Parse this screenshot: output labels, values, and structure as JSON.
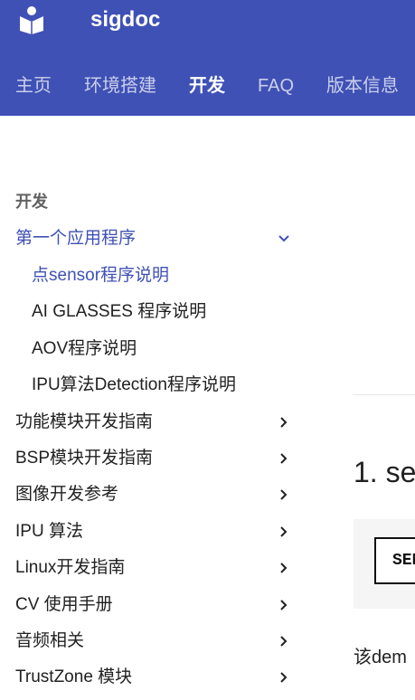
{
  "header": {
    "site_title": "sigdoc",
    "tabs": [
      {
        "label": "主页",
        "active": false
      },
      {
        "label": "环境搭建",
        "active": false
      },
      {
        "label": "开发",
        "active": true
      },
      {
        "label": "FAQ",
        "active": false
      },
      {
        "label": "版本信息",
        "active": false
      }
    ]
  },
  "nav": {
    "section_title": "开发",
    "items": [
      {
        "label": "第一个应用程序",
        "icon": "chevron-down-icon",
        "active": true
      },
      {
        "label": "点sensor程序说明",
        "active": true
      },
      {
        "label": "AI GLASSES 程序说明"
      },
      {
        "label": "AOV程序说明"
      },
      {
        "label": "IPU算法Detection程序说明"
      },
      {
        "label": "功能模块开发指南",
        "icon": "chevron-right-icon"
      },
      {
        "label": "BSP模块开发指南",
        "icon": "chevron-right-icon"
      },
      {
        "label": "图像开发参考",
        "icon": "chevron-right-icon"
      },
      {
        "label": "IPU 算法",
        "icon": "chevron-right-icon"
      },
      {
        "label": "Linux开发指南",
        "icon": "chevron-right-icon"
      },
      {
        "label": "CV 使用手册",
        "icon": "chevron-right-icon"
      },
      {
        "label": "音频相关",
        "icon": "chevron-right-icon"
      },
      {
        "label": "TrustZone 模块",
        "icon": "chevron-right-icon"
      }
    ]
  },
  "content": {
    "heading": "1. se",
    "code_box_text": "SEN",
    "paragraph": "该dem"
  },
  "colors": {
    "header_bg": "#3f51b5",
    "active_link": "#3f51b5",
    "code_bg": "#f5f5f5"
  }
}
